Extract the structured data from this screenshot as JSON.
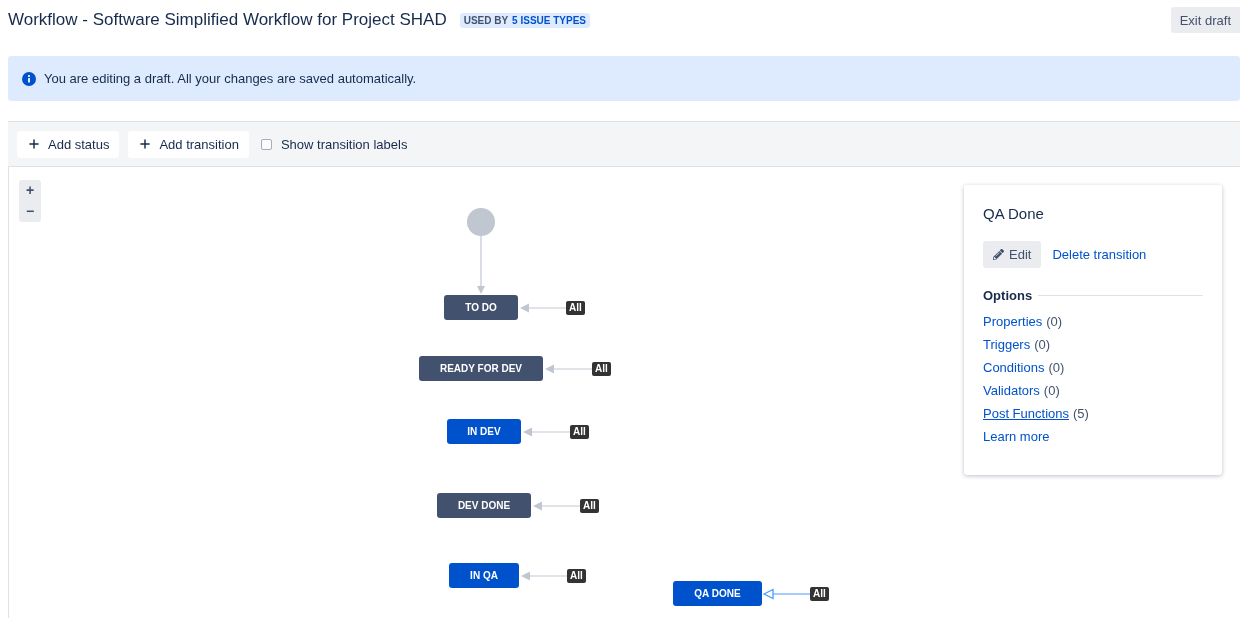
{
  "header": {
    "title": "Workflow - Software Simplified Workflow for Project SHAD",
    "badge": {
      "label": "USED BY",
      "count": "5 ISSUE TYPES"
    },
    "exit_button": "Exit draft"
  },
  "banner": {
    "message": "You are editing a draft. All your changes are saved automatically."
  },
  "toolbar": {
    "buttons": [
      {
        "label": "Add status"
      },
      {
        "label": "Add transition"
      }
    ],
    "show_labels": {
      "label": "Show transition labels",
      "checked": false
    }
  },
  "zoom_controls": [
    "+",
    "−"
  ],
  "diagram": {
    "statuses": [
      {
        "name": "TO DO",
        "color": "#42526e",
        "transition": {
          "label": "All",
          "selected": false
        }
      },
      {
        "name": "READY FOR DEV",
        "color": "#42526e",
        "transition": {
          "label": "All",
          "selected": false
        }
      },
      {
        "name": "IN DEV",
        "color": "#0052cc",
        "transition": {
          "label": "All",
          "selected": false
        }
      },
      {
        "name": "DEV DONE",
        "color": "#42526e",
        "transition": {
          "label": "All",
          "selected": false
        }
      },
      {
        "name": "IN QA",
        "color": "#0052cc",
        "transition": {
          "label": "All",
          "selected": false
        }
      },
      {
        "name": "QA DONE",
        "color": "#0052cc",
        "transition": {
          "label": "All",
          "selected": true
        }
      }
    ]
  },
  "panel": {
    "title": "QA Done",
    "edit_button": "Edit",
    "delete_link": "Delete transition",
    "options_heading": "Options",
    "options": [
      {
        "label": "Properties",
        "count": "(0)",
        "hovered": false
      },
      {
        "label": "Triggers",
        "count": "(0)",
        "hovered": false
      },
      {
        "label": "Conditions",
        "count": "(0)",
        "hovered": false
      },
      {
        "label": "Validators",
        "count": "(0)",
        "hovered": false
      },
      {
        "label": "Post Functions",
        "count": "(5)",
        "hovered": true
      }
    ],
    "learn_more": "Learn more"
  }
}
